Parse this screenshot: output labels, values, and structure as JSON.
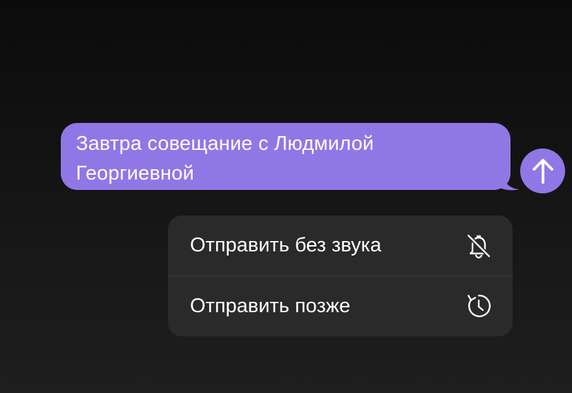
{
  "message": {
    "text_line1": "Завтра совещание с Людмилой",
    "text_line2": "Георгиевной",
    "bubble_color": "#9177e6"
  },
  "send_button": {
    "icon": "arrow-up-icon"
  },
  "send_menu": {
    "items": [
      {
        "label": "Отправить без звука",
        "icon": "bell-slash-icon"
      },
      {
        "label": "Отправить позже",
        "icon": "clock-icon"
      }
    ]
  }
}
